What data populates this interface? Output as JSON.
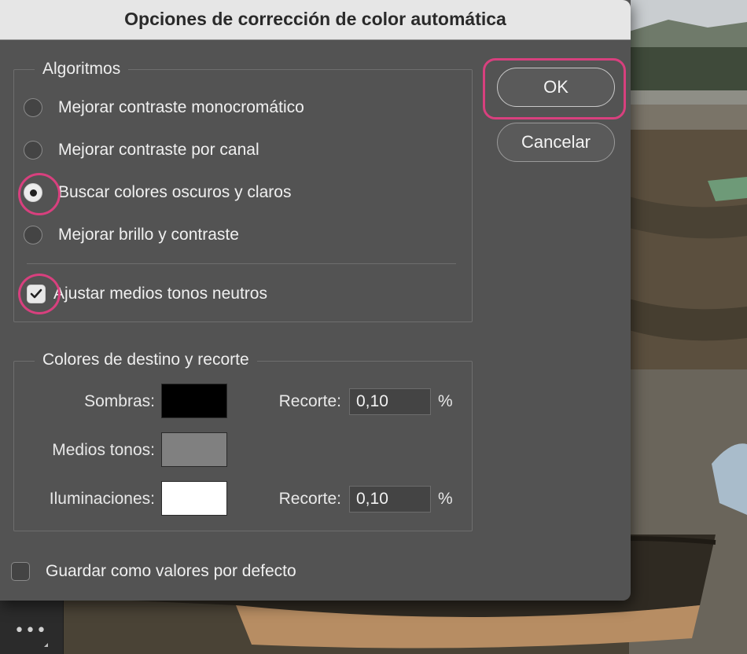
{
  "dialog": {
    "title": "Opciones de corrección de color automática"
  },
  "algorithms": {
    "legend": "Algoritmos",
    "options": [
      {
        "label": "Mejorar contraste monocromático",
        "selected": false
      },
      {
        "label": "Mejorar contraste por canal",
        "selected": false
      },
      {
        "label": "Buscar colores oscuros y claros",
        "selected": true
      },
      {
        "label": "Mejorar brillo y contraste",
        "selected": false
      }
    ],
    "snap_neutral": {
      "label": "Ajustar medios tonos neutros",
      "checked": true
    }
  },
  "target": {
    "legend": "Colores de destino y recorte",
    "shadows": {
      "label": "Sombras:",
      "color": "#000000",
      "clip_label": "Recorte:",
      "clip_value": "0,10",
      "unit": "%"
    },
    "midtones": {
      "label": "Medios tonos:",
      "color": "#808080"
    },
    "highlights": {
      "label": "Iluminaciones:",
      "color": "#ffffff",
      "clip_label": "Recorte:",
      "clip_value": "0,10",
      "unit": "%"
    }
  },
  "save_defaults": {
    "label": "Guardar como valores por defecto",
    "checked": false
  },
  "buttons": {
    "ok": "OK",
    "cancel": "Cancelar"
  },
  "toolbar": {
    "more_icon": "more-horizontal-icon",
    "more_glyph": "•••"
  },
  "colors": {
    "highlight": "#d8407e",
    "dialog_bg": "#535353",
    "titlebar_bg": "#e6e6e6"
  }
}
